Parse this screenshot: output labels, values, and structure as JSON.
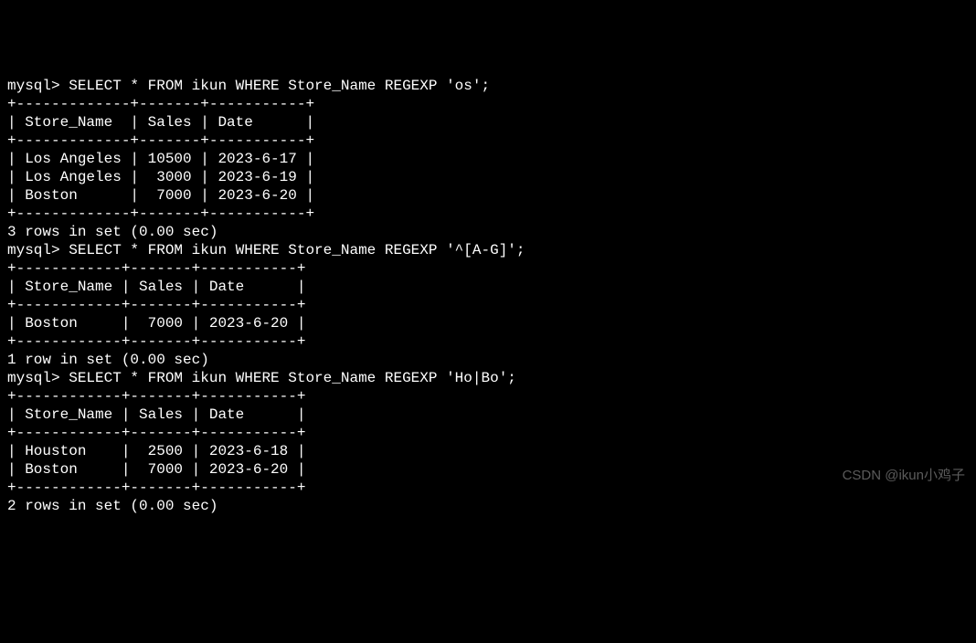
{
  "queries": [
    {
      "prompt": "mysql> ",
      "sql": "SELECT * FROM ikun WHERE Store_Name REGEXP 'os';",
      "border_top": "+-------------+-------+-----------+",
      "header": "| Store_Name  | Sales | Date      |",
      "border_mid": "+-------------+-------+-----------+",
      "rows": [
        "| Los Angeles | 10500 | 2023-6-17 |",
        "| Los Angeles |  3000 | 2023-6-19 |",
        "| Boston      |  7000 | 2023-6-20 |"
      ],
      "border_bot": "+-------------+-------+-----------+",
      "status": "3 rows in set (0.00 sec)"
    },
    {
      "prompt": "mysql> ",
      "sql": "SELECT * FROM ikun WHERE Store_Name REGEXP '^[A-G]';",
      "border_top": "+------------+-------+-----------+",
      "header": "| Store_Name | Sales | Date      |",
      "border_mid": "+------------+-------+-----------+",
      "rows": [
        "| Boston     |  7000 | 2023-6-20 |"
      ],
      "border_bot": "+------------+-------+-----------+",
      "status": "1 row in set (0.00 sec)"
    },
    {
      "prompt": "mysql> ",
      "sql": "SELECT * FROM ikun WHERE Store_Name REGEXP 'Ho|Bo';",
      "border_top": "+------------+-------+-----------+",
      "header": "| Store_Name | Sales | Date      |",
      "border_mid": "+------------+-------+-----------+",
      "rows": [
        "| Houston    |  2500 | 2023-6-18 |",
        "| Boston     |  7000 | 2023-6-20 |"
      ],
      "border_bot": "+------------+-------+-----------+",
      "status": "2 rows in set (0.00 sec)"
    }
  ],
  "watermark": "CSDN @ikun小鸡子"
}
